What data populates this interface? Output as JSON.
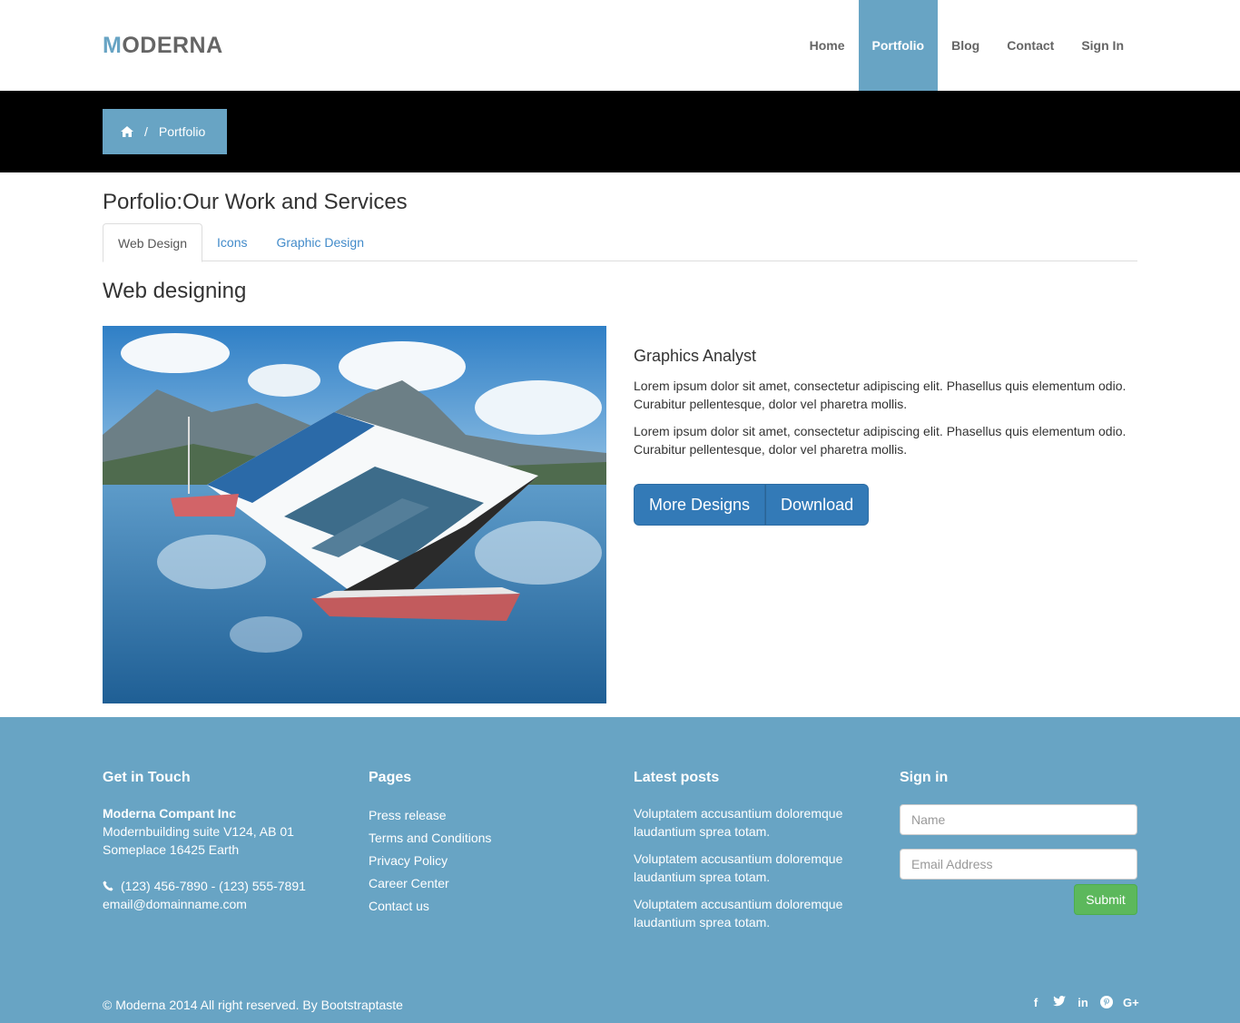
{
  "brand": {
    "first_letter": "M",
    "rest": "ODERNA"
  },
  "nav": {
    "home": "Home",
    "portfolio": "Portfolio",
    "blog": "Blog",
    "contact": "Contact",
    "signin": "Sign In"
  },
  "breadcrumb": {
    "separator": "/",
    "current": "Portfolio"
  },
  "page_title": "Porfolio:Our Work and Services",
  "tabs": [
    "Web Design",
    "Icons",
    "Graphic Design"
  ],
  "section_title": "Web designing",
  "info": {
    "heading": "Graphics Analyst",
    "paragraphs": [
      "Lorem ipsum dolor sit amet, consectetur adipiscing elit. Phasellus quis elementum odio. Curabitur pellentesque, dolor vel pharetra mollis.",
      "Lorem ipsum dolor sit amet, consectetur adipiscing elit. Phasellus quis elementum odio. Curabitur pellentesque, dolor vel pharetra mollis."
    ],
    "btn_more": "More Designs",
    "btn_download": "Download"
  },
  "footer": {
    "contact": {
      "title": "Get in Touch",
      "company": "Moderna Compant Inc",
      "address1": "Modernbuilding suite V124, AB 01",
      "address2": "Someplace 16425 Earth",
      "phone": "(123) 456-7890 - (123) 555-7891",
      "email": "email@domainname.com"
    },
    "pages": {
      "title": "Pages",
      "links": [
        "Press release",
        "Terms and Conditions",
        "Privacy Policy",
        "Career Center",
        "Contact us"
      ]
    },
    "posts": {
      "title": "Latest posts",
      "items": [
        "Voluptatem accusantium doloremque laudantium sprea totam.",
        "Voluptatem accusantium doloremque laudantium sprea totam.",
        "Voluptatem accusantium doloremque laudantium sprea totam."
      ]
    },
    "signin": {
      "title": "Sign in",
      "name_placeholder": "Name",
      "email_placeholder": "Email Address",
      "submit": "Submit"
    },
    "copyright": "© Moderna 2014 All right reserved. By Bootstraptaste",
    "social_icons": [
      "facebook-icon",
      "twitter-icon",
      "linkedin-icon",
      "pinterest-icon",
      "google-plus-icon"
    ]
  },
  "colors": {
    "accent": "#68a4c4",
    "primary_button": "#337ab7",
    "success_button": "#5cb85c"
  }
}
